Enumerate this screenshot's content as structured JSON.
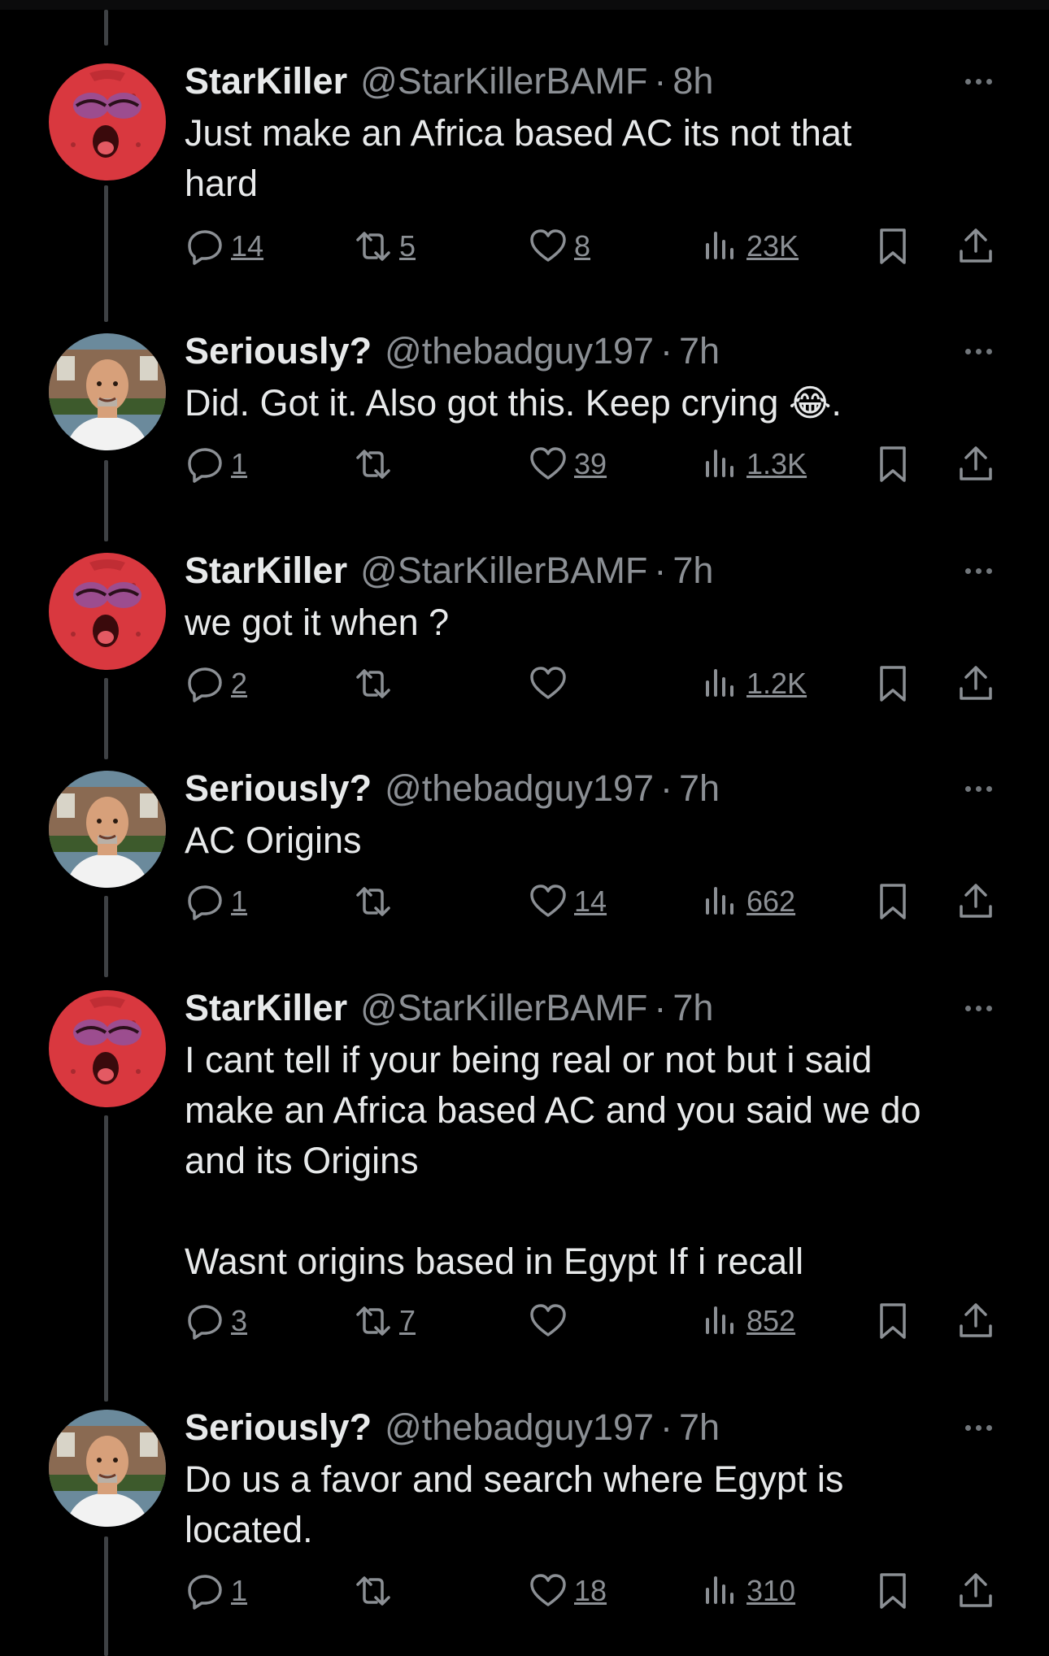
{
  "tweets": [
    {
      "name": "StarKiller",
      "handle": "@StarKillerBAMF",
      "sep": "·",
      "time": "8h",
      "text": "Just make an Africa based AC its not that\nhard",
      "replies": "14",
      "retweets": "5",
      "likes": "8",
      "views": "23K",
      "avatar": "patrick-avatar"
    },
    {
      "name": "Seriously?",
      "handle": "@thebadguy197",
      "sep": "·",
      "time": "7h",
      "text": "Did. Got it. Also got this. Keep crying 😂.",
      "replies": "1",
      "retweets": "",
      "likes": "39",
      "views": "1.3K",
      "avatar": "man-avatar"
    },
    {
      "name": "StarKiller",
      "handle": "@StarKillerBAMF",
      "sep": "·",
      "time": "7h",
      "text": "we got it when ?",
      "replies": "2",
      "retweets": "",
      "likes": "",
      "views": "1.2K",
      "avatar": "patrick-avatar"
    },
    {
      "name": "Seriously?",
      "handle": "@thebadguy197",
      "sep": "·",
      "time": "7h",
      "text": "AC Origins",
      "replies": "1",
      "retweets": "",
      "likes": "14",
      "views": "662",
      "avatar": "man-avatar"
    },
    {
      "name": "StarKiller",
      "handle": "@StarKillerBAMF",
      "sep": "·",
      "time": "7h",
      "text": "I cant tell if your being real or not but i said\nmake an Africa based AC and you said we do\nand its Origins\n\nWasnt origins based in Egypt If i recall",
      "replies": "3",
      "retweets": "7",
      "likes": "",
      "views": "852",
      "avatar": "patrick-avatar"
    },
    {
      "name": "Seriously?",
      "handle": "@thebadguy197",
      "sep": "·",
      "time": "7h",
      "text": "Do us a favor and search where Egypt is\nlocated.",
      "replies": "1",
      "retweets": "",
      "likes": "18",
      "views": "310",
      "avatar": "man-avatar"
    }
  ],
  "colors": {
    "background": "#000000",
    "text": "#e7e9ea",
    "muted": "#8b8f94",
    "thread_line": "#3e4144"
  }
}
